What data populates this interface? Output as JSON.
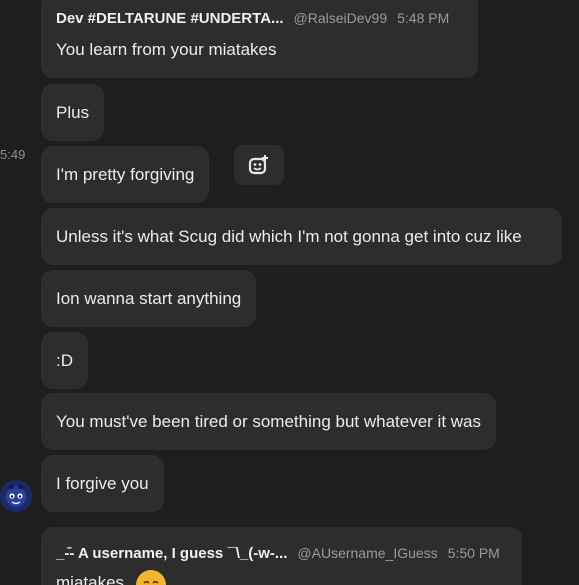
{
  "messages": [
    {
      "author": "Dev #DELTARUNE #UNDERTA...",
      "handle": "@RalseiDev99",
      "time": "5:48 PM",
      "text": "You learn from your miatakes"
    },
    {
      "text": "Plus"
    },
    {
      "text": "I'm pretty forgiving"
    },
    {
      "text": "Unless it's what Scug did which I'm not gonna get into cuz like"
    },
    {
      "text": "Ion wanna start anything"
    },
    {
      "text": ":D"
    },
    {
      "text": "You must've been tired or something but whatever it was"
    },
    {
      "text": "I forgive you"
    },
    {
      "author": "_-̄- A username, I guess ¯\\_(-w-...",
      "handle": "@AUsername_IGuess",
      "time": "5:50 PM",
      "text": "miatakes"
    }
  ],
  "hover_time": "5:49",
  "icons": {
    "add_reaction": "add-reaction-icon",
    "avatar": "user-avatar",
    "emoji": "smiling-emoji"
  },
  "colors": {
    "background": "#1e1e1e",
    "bubble": "#2d2d2d",
    "text": "#ececec",
    "muted": "#9a9a9a"
  }
}
